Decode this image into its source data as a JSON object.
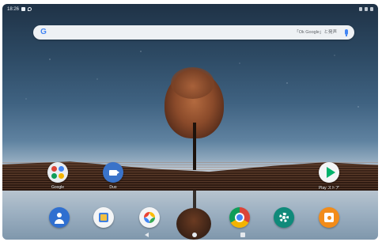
{
  "status_bar": {
    "time": "18:26"
  },
  "search_bar": {
    "logo": "G",
    "hint": "「Ok Google」と発声"
  },
  "home_apps": [
    {
      "label": "Google",
      "icon": "google-folder-icon"
    },
    {
      "label": "Duo",
      "icon": "duo-icon"
    },
    {
      "label": "Play ストア",
      "icon": "play-store-icon"
    }
  ],
  "dock": [
    {
      "icon": "contacts-icon"
    },
    {
      "icon": "files-icon"
    },
    {
      "icon": "photos-icon"
    },
    {
      "icon": "chrome-icon"
    },
    {
      "icon": "settings-icon"
    },
    {
      "icon": "music-icon"
    }
  ],
  "navigation": [
    "back",
    "home",
    "recents"
  ],
  "colors": {
    "sky_top": "#1f3246",
    "sky_horizon": "#b9c6d2",
    "land": "#3c2418",
    "accent_blue": "#4285f4"
  }
}
